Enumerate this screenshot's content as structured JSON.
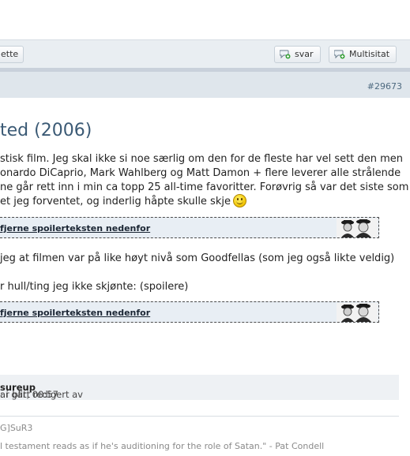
{
  "toolbar": {
    "left_button_label": "ette",
    "reply_label": "svar",
    "multiquote_label": "Multisitat"
  },
  "post": {
    "number": "#29673",
    "title": "ted (2006)",
    "paragraph1": [
      "stisk film. Jeg skal ikke si noe særlig om den for de fleste har vel sett den men",
      "onardo DiCaprio, Mark Wahlberg og Matt Damon + flere leverer alle strålende",
      "ne går rett inn i min ca topp 25 all-time favoritter. Forøvrig så var det siste som",
      "et jeg forventet, og inderlig håpte skulle skje"
    ],
    "spoiler1_label": "fjerne spoilerteksten nedenfor",
    "paragraph2": " jeg at filmen var på like høyt nivå som Goodfellas (som jeg også likte veldig)",
    "paragraph3": "r hull/ting jeg ikke skjønte: (spoilere)",
    "spoiler2_label": "fjerne spoilerteksten nedenfor"
  },
  "edit": {
    "prefix": "ar blitt redigert av ",
    "editor": "sureup",
    "suffix": ": i går, 00:57"
  },
  "signature": {
    "line1": "G]SuR3",
    "line2": "l testament reads as if he's auditioning for the role of Satan.\" - Pat Condell"
  }
}
